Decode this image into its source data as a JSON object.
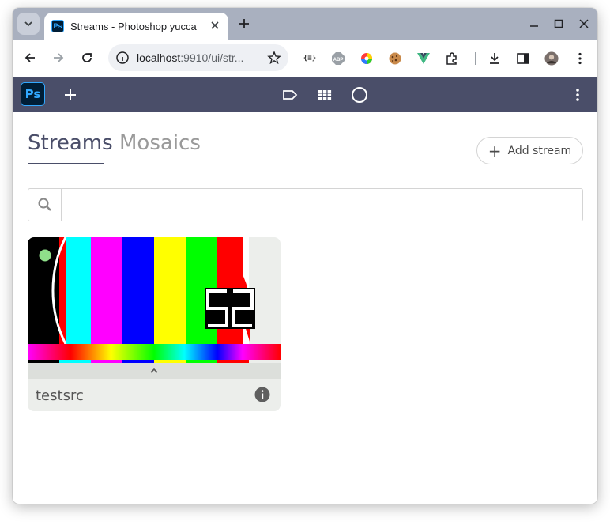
{
  "browser": {
    "tab_title": "Streams - Photoshop yucca",
    "tab_favicon_text": "Ps",
    "url_host": "localhost",
    "url_rest": ":9910/ui/str..."
  },
  "appbar": {
    "logo_text": "Ps",
    "accent": "#4a4e69"
  },
  "page": {
    "tabs": [
      {
        "label": "Streams",
        "active": true
      },
      {
        "label": "Mosaics",
        "active": false
      }
    ],
    "add_stream_label": "Add stream",
    "search_placeholder": ""
  },
  "streams": [
    {
      "name": "testsrc",
      "counter": "52",
      "status_color": "#8fe08a"
    }
  ]
}
